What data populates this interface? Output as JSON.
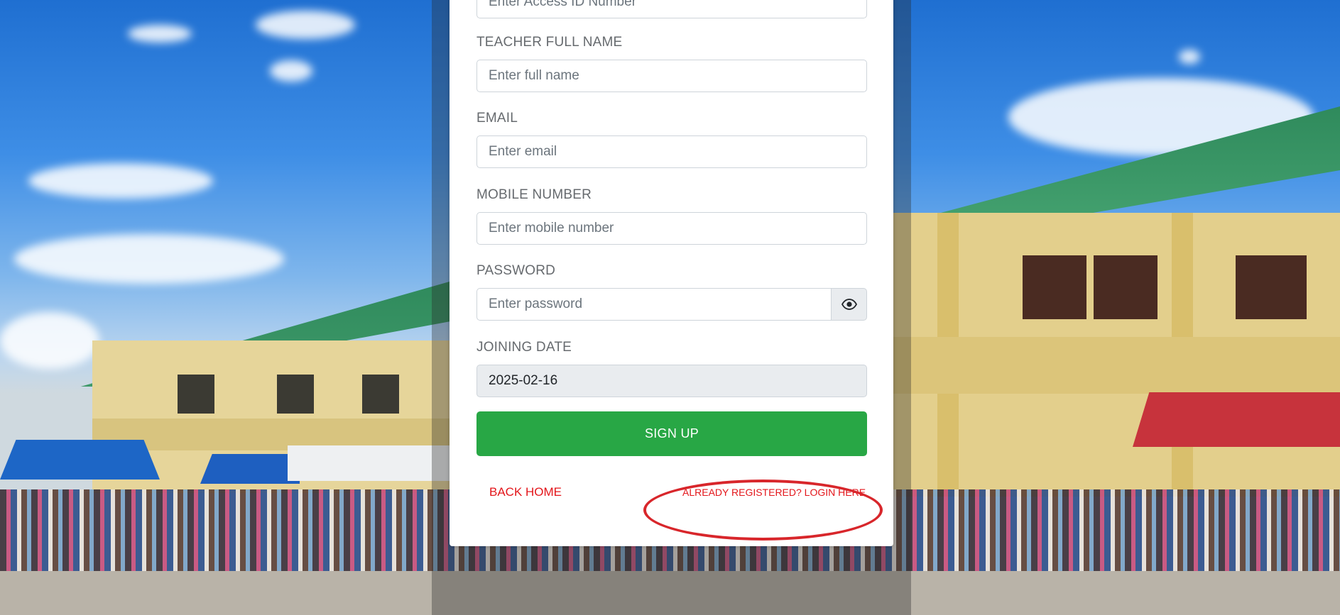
{
  "form": {
    "access_id": {
      "placeholder": "Enter Access ID Number"
    },
    "full_name": {
      "label": "TEACHER FULL NAME",
      "placeholder": "Enter full name"
    },
    "email": {
      "label": "EMAIL",
      "placeholder": "Enter email"
    },
    "mobile": {
      "label": "MOBILE NUMBER",
      "placeholder": "Enter mobile number"
    },
    "password": {
      "label": "PASSWORD",
      "placeholder": "Enter password",
      "toggle_icon": "eye-icon"
    },
    "joining_date": {
      "label": "JOINING DATE",
      "value": "2025-02-16"
    },
    "submit_label": "SIGN UP"
  },
  "links": {
    "back_home": "BACK HOME",
    "login": "ALREADY REGISTERED? LOGIN HERE"
  },
  "colors": {
    "primary_button": "#28a745",
    "link": "#e3161b",
    "highlight_ellipse": "#d8262b"
  }
}
